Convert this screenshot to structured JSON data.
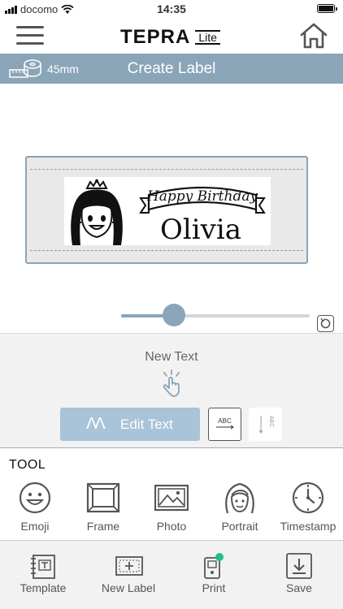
{
  "status_bar": {
    "carrier": "docomo",
    "time": "14:35"
  },
  "header": {
    "brand_main": "TEPRA",
    "brand_sub": "Lite"
  },
  "title_bar": {
    "tape_width": "45mm",
    "title": "Create Label"
  },
  "label": {
    "banner_text": "Happy Birthday",
    "name_text": "Olivia"
  },
  "size_slider": {
    "level": 0.28
  },
  "edit_panel": {
    "selected_object": "New Text",
    "edit_text_label": "Edit Text",
    "horizontal_text_icon_text": "ABC",
    "vertical_text_icon_text": "ABC"
  },
  "tools": {
    "title": "TOOL",
    "items": [
      {
        "label": "Emoji",
        "icon": "emoji-icon"
      },
      {
        "label": "Frame",
        "icon": "frame-icon"
      },
      {
        "label": "Photo",
        "icon": "photo-icon"
      },
      {
        "label": "Portrait",
        "icon": "portrait-icon"
      },
      {
        "label": "Timestamp",
        "icon": "timestamp-icon"
      }
    ]
  },
  "bottom_bar": {
    "items": [
      {
        "label": "Template",
        "icon": "template-icon"
      },
      {
        "label": "New Label",
        "icon": "new-label-icon"
      },
      {
        "label": "Print",
        "icon": "print-icon"
      },
      {
        "label": "Save",
        "icon": "save-icon"
      }
    ]
  },
  "colors": {
    "accent": "#8aa4b8",
    "button": "#a9c3d8",
    "print_status": "#1fbf8f"
  }
}
